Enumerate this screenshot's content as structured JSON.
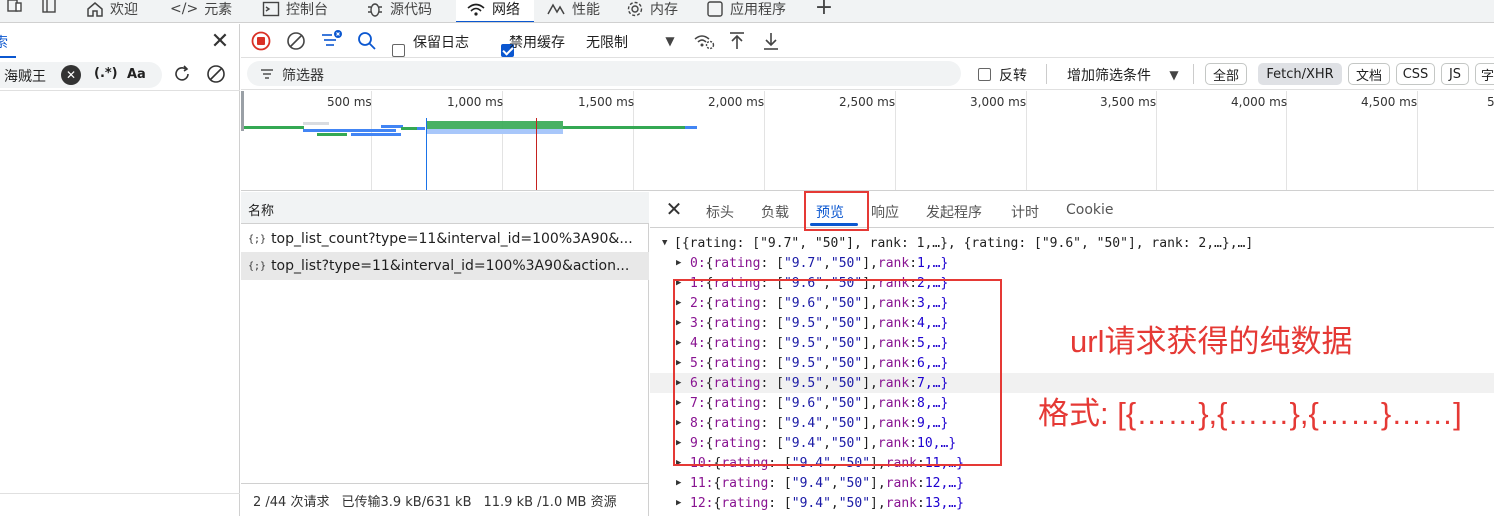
{
  "top_tabs": [
    {
      "label": "欢迎",
      "icon": "home-icon"
    },
    {
      "label": "元素",
      "icon": "code-icon"
    },
    {
      "label": "控制台",
      "icon": "console-icon"
    },
    {
      "label": "源代码",
      "icon": "bug-icon"
    },
    {
      "label": "网络",
      "icon": "wifi-icon"
    },
    {
      "label": "性能",
      "icon": "performance-icon"
    },
    {
      "label": "内存",
      "icon": "gear-icon"
    },
    {
      "label": "应用程序",
      "icon": "window-icon"
    }
  ],
  "left_pane": {
    "search_value": "海贼王",
    "regex_label": "(.*)",
    "case_label": "Aa"
  },
  "toolbar": {
    "preserve_log_label": "保留日志",
    "disable_cache_label": "禁用缓存",
    "throttle_label": "无限制"
  },
  "filter_bar": {
    "placeholder": "筛选器",
    "invert_label": "反转",
    "more_filters_label": "增加筛选条件",
    "type_filters": [
      "全部",
      "Fetch/XHR",
      "文档",
      "CSS",
      "JS",
      "字"
    ]
  },
  "timeline": {
    "ticks": [
      "500 ms",
      "1,000 ms",
      "1,500 ms",
      "2,000 ms",
      "2,500 ms",
      "3,000 ms",
      "3,500 ms",
      "4,000 ms",
      "4,500 ms",
      "5"
    ]
  },
  "request_list": {
    "header": "名称",
    "rows": [
      {
        "icon": "{;}",
        "name": "top_list_count?type=11&interval_id=100%3A90&..."
      },
      {
        "icon": "{;}",
        "name": "top_list?type=11&interval_id=100%3A90&action..."
      }
    ]
  },
  "status_bar": {
    "requests": "2 /44 次请求",
    "transferred": "已传输3.9 kB/631 kB",
    "resources": "11.9 kB /1.0 MB 资源"
  },
  "detail_tabs": [
    "标头",
    "负载",
    "预览",
    "响应",
    "发起程序",
    "计时",
    "Cookie"
  ],
  "preview": {
    "root_line": "[{rating: [\"9.7\", \"50\"], rank: 1,…}, {rating: [\"9.6\", \"50\"], rank: 2,…},…]",
    "items": [
      {
        "index": "0",
        "rating": "\"9.7\"",
        "count": "\"50\"",
        "rank": "1,…}"
      },
      {
        "index": "1",
        "rating": "\"9.6\"",
        "count": "\"50\"",
        "rank": "2,…}"
      },
      {
        "index": "2",
        "rating": "\"9.6\"",
        "count": "\"50\"",
        "rank": "3,…}"
      },
      {
        "index": "3",
        "rating": "\"9.5\"",
        "count": "\"50\"",
        "rank": "4,…}"
      },
      {
        "index": "4",
        "rating": "\"9.5\"",
        "count": "\"50\"",
        "rank": "5,…}"
      },
      {
        "index": "5",
        "rating": "\"9.5\"",
        "count": "\"50\"",
        "rank": "6,…}"
      },
      {
        "index": "6",
        "rating": "\"9.5\"",
        "count": "\"50\"",
        "rank": "7,…}"
      },
      {
        "index": "7",
        "rating": "\"9.6\"",
        "count": "\"50\"",
        "rank": "8,…}"
      },
      {
        "index": "8",
        "rating": "\"9.4\"",
        "count": "\"50\"",
        "rank": "9,…}"
      },
      {
        "index": "9",
        "rating": "\"9.4\"",
        "count": "\"50\"",
        "rank": "10,…}"
      },
      {
        "index": "10",
        "rating": "\"9.4\"",
        "count": "\"50\"",
        "rank": "11,…}"
      },
      {
        "index": "11",
        "rating": "\"9.4\"",
        "count": "\"50\"",
        "rank": "12,…}"
      },
      {
        "index": "12",
        "rating": "\"9.4\"",
        "count": "\"50\"",
        "rank": "13,…}"
      }
    ]
  },
  "annotations": {
    "note1": "url请求获得的纯数据",
    "note2": "格式: [{……},{……},{……}……]"
  },
  "colors": {
    "accent": "#0b57d0",
    "annotation_red": "#e53935",
    "record_red": "#d93025",
    "timeline_green": "#34a853",
    "timeline_blue": "#4285f4"
  }
}
